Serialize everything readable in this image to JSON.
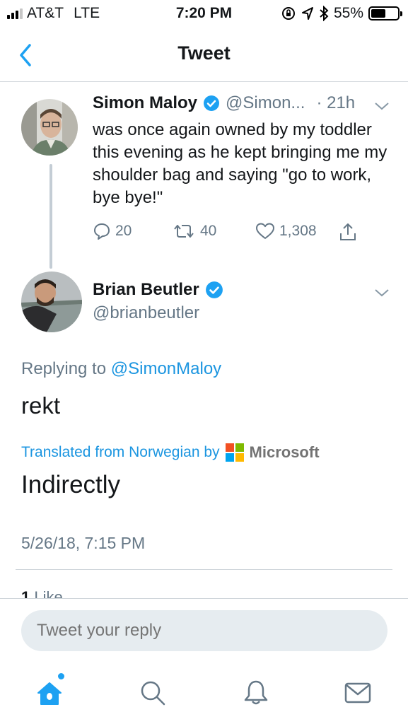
{
  "status_bar": {
    "carrier": "AT&T",
    "network": "LTE",
    "time": "7:20 PM",
    "battery": "55%",
    "battery_level": 0.55
  },
  "nav": {
    "title": "Tweet",
    "back_icon": "chevron-left-icon"
  },
  "tweet1": {
    "name": "Simon Maloy",
    "handle": "@Simon...",
    "time": "· 21h",
    "text": "was once again owned by my toddler this evening as he kept bringing me my shoulder bag and saying \"go to work, bye bye!\"",
    "replies": "20",
    "retweets": "40",
    "likes": "1,308"
  },
  "tweet2": {
    "name": "Brian Beutler",
    "handle": "@brianbeutler",
    "replying_prefix": "Replying to",
    "replying_to": "@SimonMaloy",
    "text": "rekt",
    "translated_label": "Translated from Norwegian by",
    "translator": "Microsoft",
    "translation": "Indirectly",
    "timestamp": "5/26/18, 7:15 PM",
    "likes_count": "1",
    "likes_label": "Like"
  },
  "reply": {
    "placeholder": "Tweet your reply"
  },
  "tabs": [
    "home-icon",
    "search-icon",
    "notifications-icon",
    "messages-icon"
  ],
  "colors": {
    "accent": "#1da1f2",
    "link": "#1b95e0",
    "muted": "#657786"
  }
}
